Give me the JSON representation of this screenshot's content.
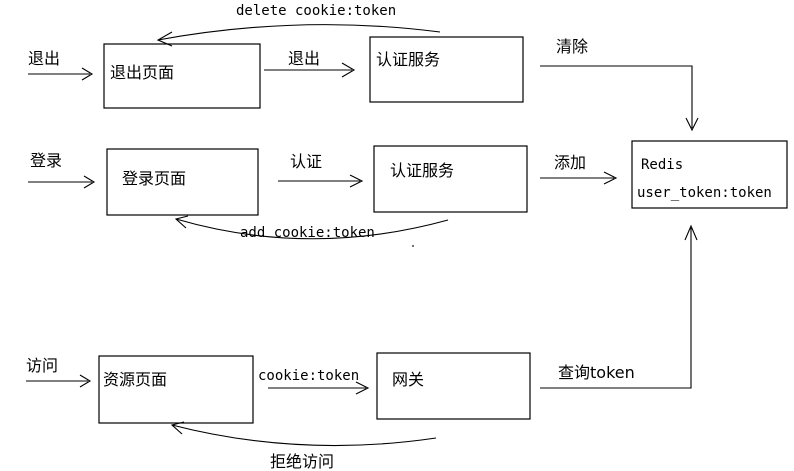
{
  "logout": {
    "trigger": "退出",
    "page": "退出页面",
    "call": "退出",
    "service": "认证服务",
    "store_action": "清除",
    "response": "delete cookie:token"
  },
  "login": {
    "trigger": "登录",
    "page": "登录页面",
    "call": "认证",
    "service": "认证服务",
    "store_action": "添加",
    "response": "add cookie:token"
  },
  "access": {
    "trigger": "访问",
    "page": "资源页面",
    "call": "cookie:token",
    "gateway": "网关",
    "store_action": "查询token",
    "response": "拒绝访问"
  },
  "redis": {
    "title": "Redis",
    "entry": "user_token:token"
  }
}
